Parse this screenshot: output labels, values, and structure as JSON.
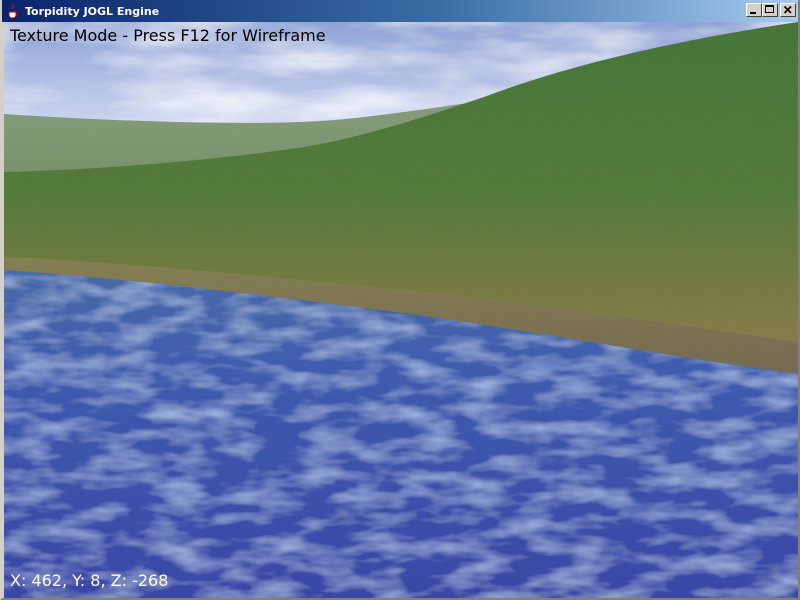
{
  "window": {
    "title": "Torpidity JOGL Engine",
    "icon": "java-cup-icon"
  },
  "title_buttons": {
    "minimize": "minimize-icon",
    "maximize": "maximize-icon",
    "close": "close-icon"
  },
  "hud": {
    "mode_text": "Texture Mode - Press F12 for Wireframe",
    "coords_text": "X: 462, Y: 8, Z: -268"
  },
  "colors": {
    "titlebar_start": "#0a246a",
    "titlebar_end": "#a6caf0",
    "sky": "#b9c7e6",
    "grass": "#4f7a3a",
    "sand": "#9c8a5e",
    "water": "#3e50a8"
  }
}
